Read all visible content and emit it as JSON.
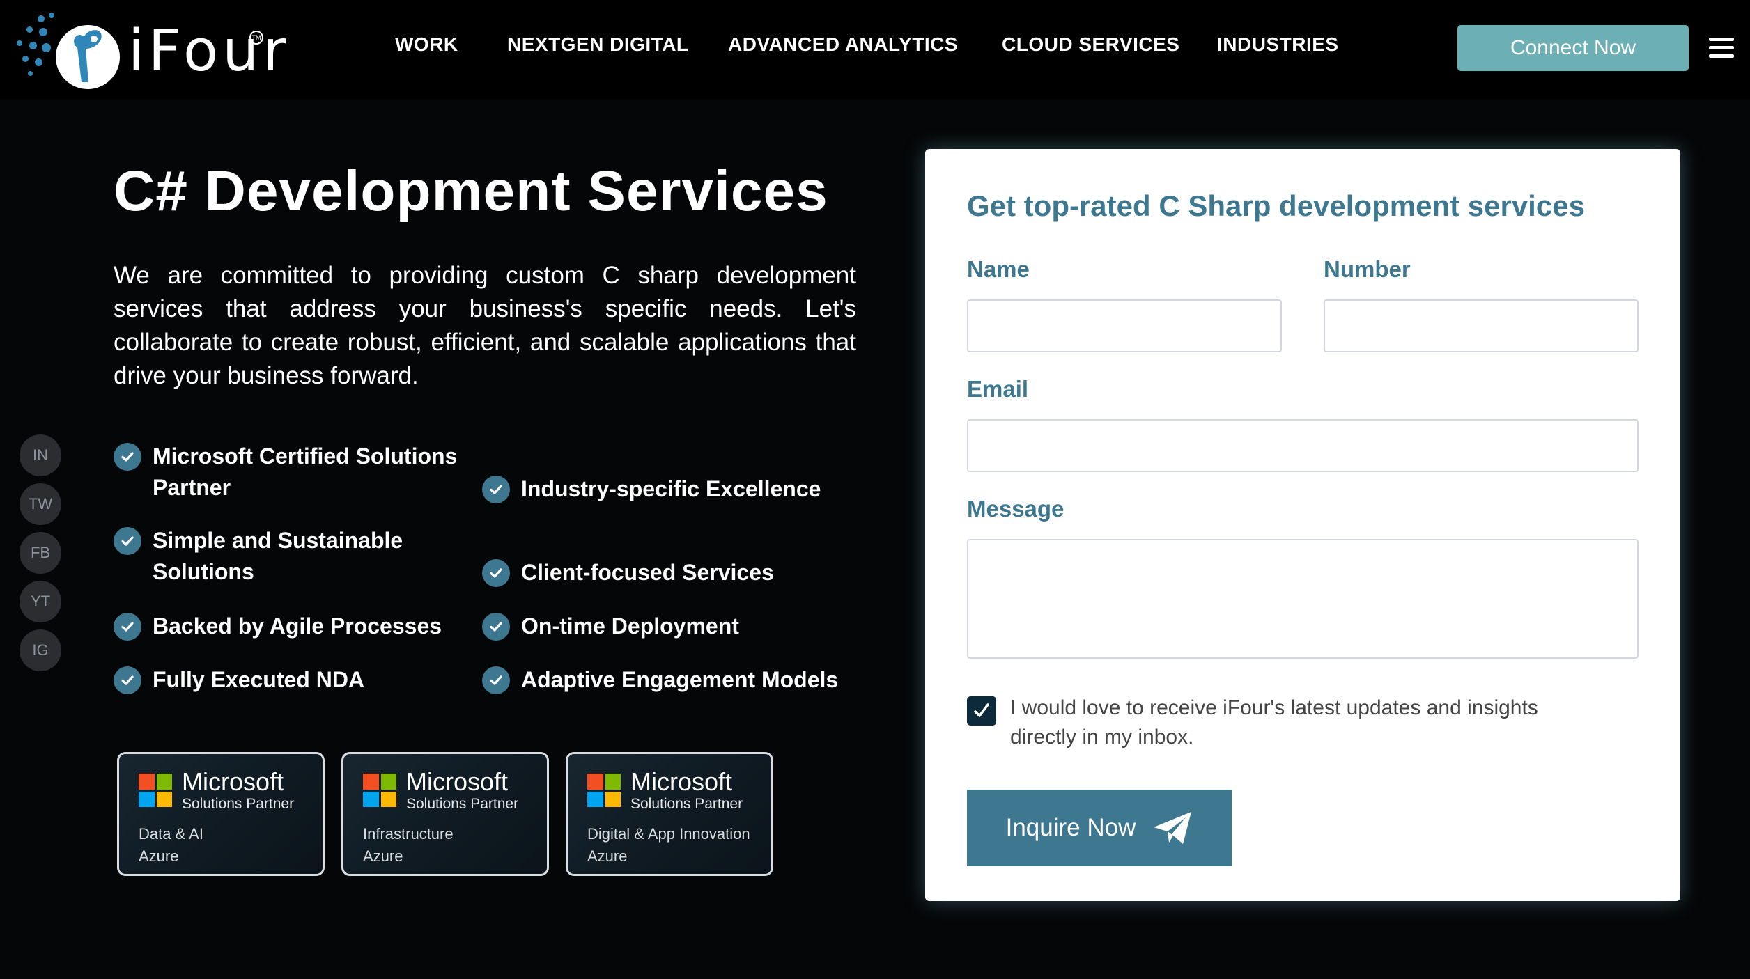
{
  "brand": {
    "name": "iFour",
    "tm": "TM"
  },
  "nav": {
    "items": [
      "WORK",
      "NEXTGEN DIGITAL",
      "ADVANCED ANALYTICS",
      "CLOUD SERVICES",
      "INDUSTRIES"
    ],
    "cta": "Connect Now"
  },
  "social": [
    "IN",
    "TW",
    "FB",
    "YT",
    "IG"
  ],
  "hero": {
    "title": "C# Development Services",
    "description": "We are committed to providing custom C sharp development services that address your business's specific needs. Let's collaborate to create robust, efficient, and scalable applications that drive your business forward.",
    "features_left": [
      "Microsoft Certified Solutions Partner",
      "Simple and Sustainable Solutions",
      "Backed by Agile Processes",
      "Fully Executed NDA"
    ],
    "features_right": [
      "Industry-specific Excellence",
      "Client-focused Services",
      "On-time Deployment",
      "Adaptive Engagement Models"
    ]
  },
  "badges": [
    {
      "brand": "Microsoft",
      "subtitle": "Solutions Partner",
      "line1": "Data & AI",
      "line2": "Azure"
    },
    {
      "brand": "Microsoft",
      "subtitle": "Solutions Partner",
      "line1": "Infrastructure",
      "line2": "Azure"
    },
    {
      "brand": "Microsoft",
      "subtitle": "Solutions Partner",
      "line1": "Digital & App Innovation",
      "line2": "Azure"
    }
  ],
  "form": {
    "title": "Get top-rated C Sharp development services",
    "name_label": "Name",
    "number_label": "Number",
    "email_label": "Email",
    "message_label": "Message",
    "name_value": "",
    "number_value": "",
    "email_value": "",
    "message_value": "",
    "optin_checked": true,
    "optin_text": "I would love to receive iFour's latest updates and insights directly in my inbox.",
    "submit_label": "Inquire Now"
  },
  "colors": {
    "accent": "#3e7790",
    "cta": "#6cb0b6",
    "background": "#050608",
    "ms_red": "#f25022",
    "ms_green": "#7fba00",
    "ms_blue": "#00a4ef",
    "ms_yellow": "#ffb900"
  },
  "icons": {
    "feature": "check-circle-icon",
    "submit": "paper-plane-icon",
    "menu": "hamburger-menu-icon"
  }
}
